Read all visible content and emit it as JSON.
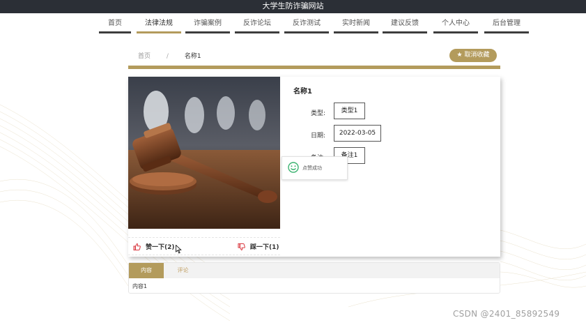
{
  "site": {
    "title": "大学生防诈骗网站"
  },
  "nav": {
    "items": [
      {
        "label": "首页",
        "active": false
      },
      {
        "label": "法律法规",
        "active": true
      },
      {
        "label": "诈骗案例",
        "active": false
      },
      {
        "label": "反诈论坛",
        "active": false
      },
      {
        "label": "反诈测试",
        "active": false
      },
      {
        "label": "实时新闻",
        "active": false
      },
      {
        "label": "建议反馈",
        "active": false
      },
      {
        "label": "个人中心",
        "active": false
      },
      {
        "label": "后台管理",
        "active": false
      }
    ]
  },
  "breadcrumb": {
    "home": "首页",
    "separator": "/",
    "current": "名称1"
  },
  "favorite": {
    "label": "取消收藏",
    "icon": "star-icon"
  },
  "detail": {
    "title": "名称1",
    "fields": [
      {
        "label": "类型:",
        "value": "类型1"
      },
      {
        "label": "日期:",
        "value": "2022-03-05"
      },
      {
        "label": "备注:",
        "value": "备注1"
      }
    ]
  },
  "votes": {
    "like_label": "赞一下(2)",
    "dislike_label": "踩一下(1)"
  },
  "toast": {
    "message": "点赞成功",
    "icon": "smile-icon"
  },
  "tabs": {
    "items": [
      {
        "label": "内容",
        "active": true
      },
      {
        "label": "评论",
        "active": false
      }
    ],
    "content": "内容1"
  },
  "watermark": "CSDN @2401_85892549",
  "colors": {
    "accent": "#b39b5c",
    "topbar": "#2b2f36",
    "like": "#d9363e"
  }
}
